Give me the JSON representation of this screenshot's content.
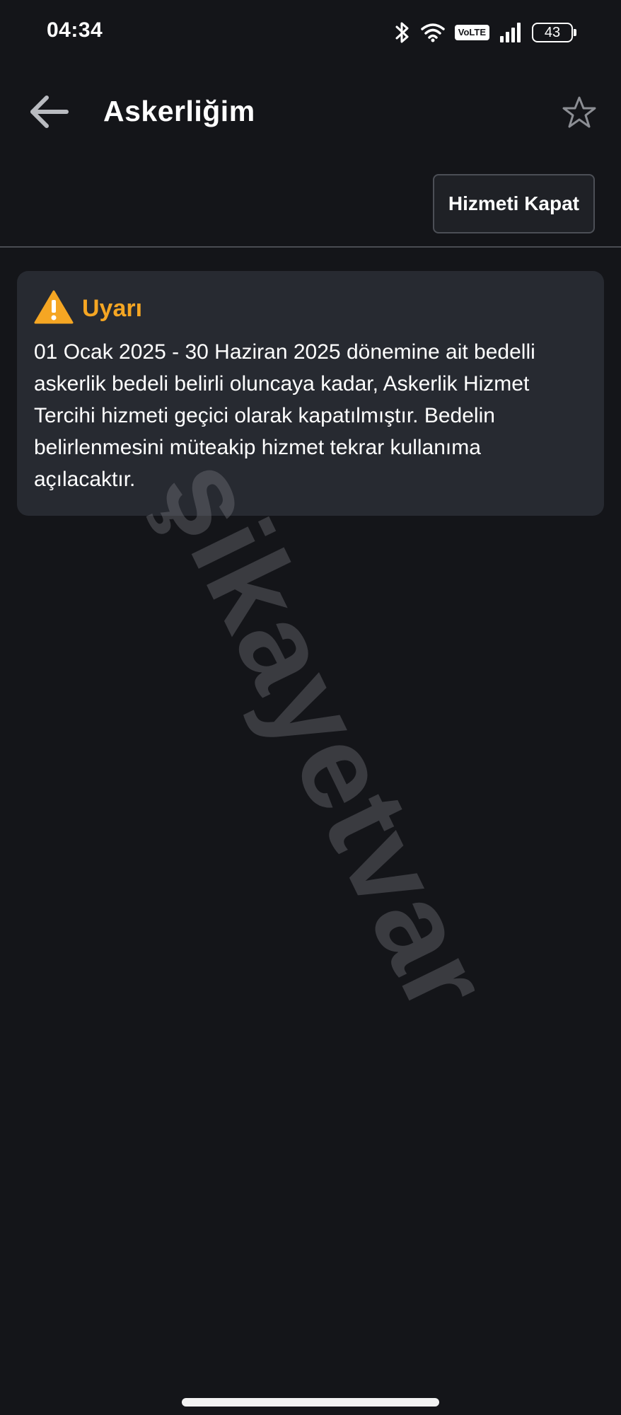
{
  "status_bar": {
    "time": "04:34",
    "volte_label": "VoLTE",
    "battery_level": "43",
    "icons": [
      "bluetooth-icon",
      "wifi-icon",
      "volte-icon",
      "signal-icon",
      "battery-icon"
    ]
  },
  "app_bar": {
    "title": "Askerliğim",
    "back_icon": "arrow-left-icon",
    "favorite_icon": "star-outline-icon"
  },
  "actions": {
    "close_service_label": "Hizmeti Kapat"
  },
  "alert": {
    "icon": "warning-triangle-icon",
    "title": "Uyarı",
    "message": "01 Ocak 2025 - 30 Haziran 2025 dönemine ait bedelli askerlik bedeli belirli oluncaya kadar, Askerlik Hizmet Tercihi hizmeti geçici olarak kapatılmıştır. Bedelin belirlenmesini müteakip hizmet tekrar kullanıma açılacaktır."
  },
  "watermark": {
    "text": "şikayetvar"
  },
  "colors": {
    "background": "#141519",
    "card": "#272a31",
    "warning": "#f5a623",
    "text": "#ffffff"
  }
}
